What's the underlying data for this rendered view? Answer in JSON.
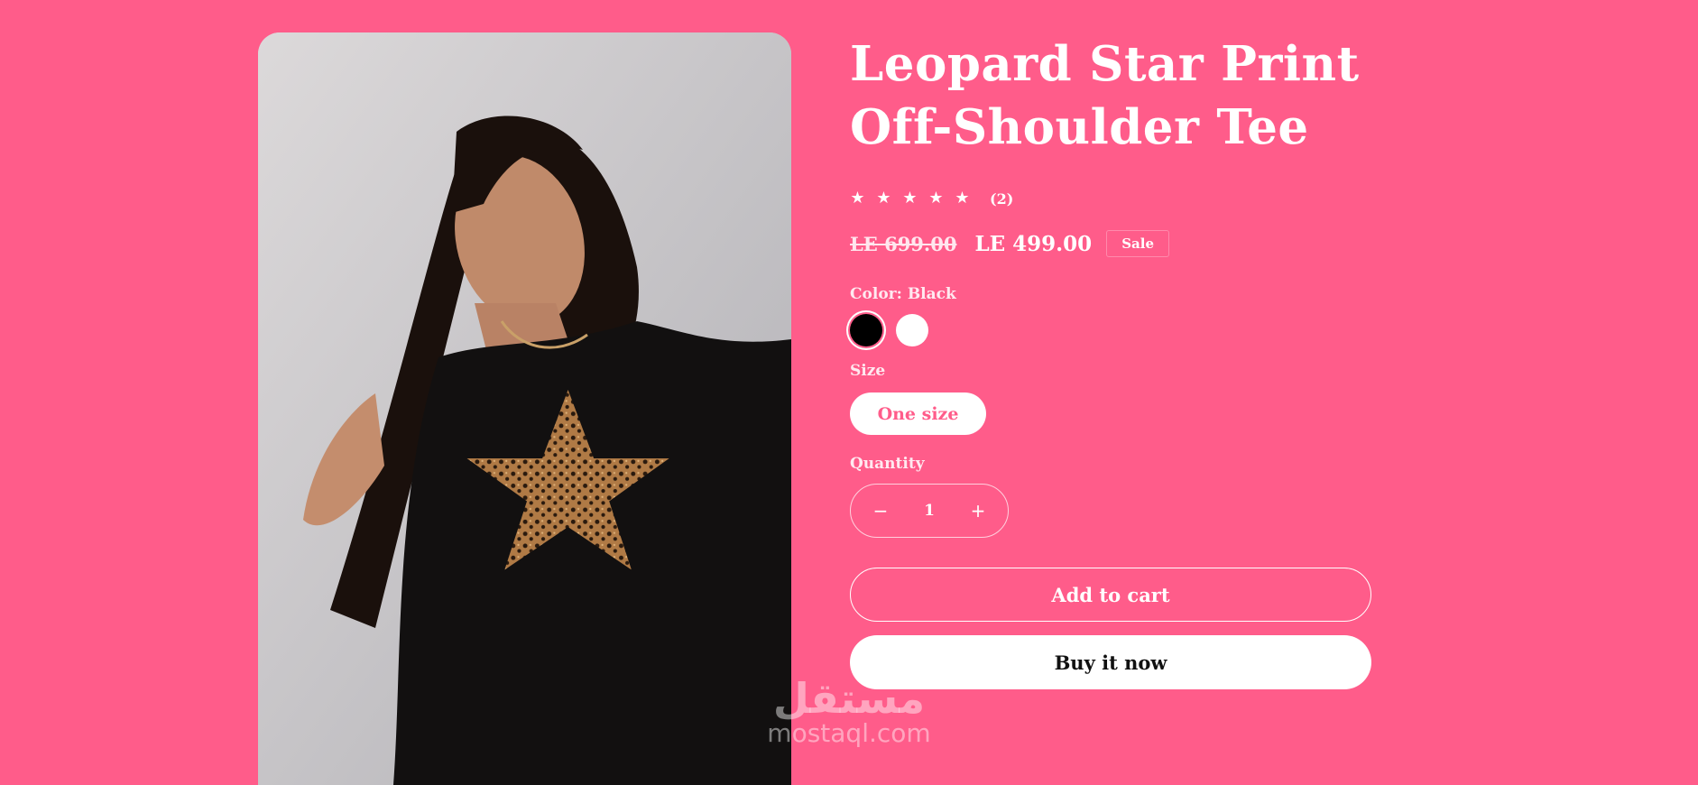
{
  "product": {
    "title": "Leopard Star Print Off-Shoulder Tee",
    "rating_stars": [
      "★",
      "★",
      "★",
      "★",
      "★"
    ],
    "rating_value": 5,
    "rating_count": "(2)",
    "price_regular": "LE 699.00",
    "price_sale": "LE 499.00",
    "sale_badge": "Sale",
    "color_label": "Color: Black",
    "colors": [
      {
        "name": "Black",
        "hex": "#000000",
        "selected": true
      },
      {
        "name": "White",
        "hex": "#ffffff",
        "selected": false
      }
    ],
    "size_label": "Size",
    "size_option": "One size",
    "quantity_label": "Quantity",
    "quantity_minus": "−",
    "quantity_value": "1",
    "quantity_plus": "+",
    "add_to_cart": "Add to cart",
    "buy_now": "Buy it now"
  },
  "watermark": {
    "logo": "مستقل",
    "text": "mostaql.com"
  },
  "colors": {
    "background": "#ff5c8a",
    "text": "#ffffff",
    "button_buy_bg": "#ffffff",
    "button_buy_text": "#111111"
  }
}
